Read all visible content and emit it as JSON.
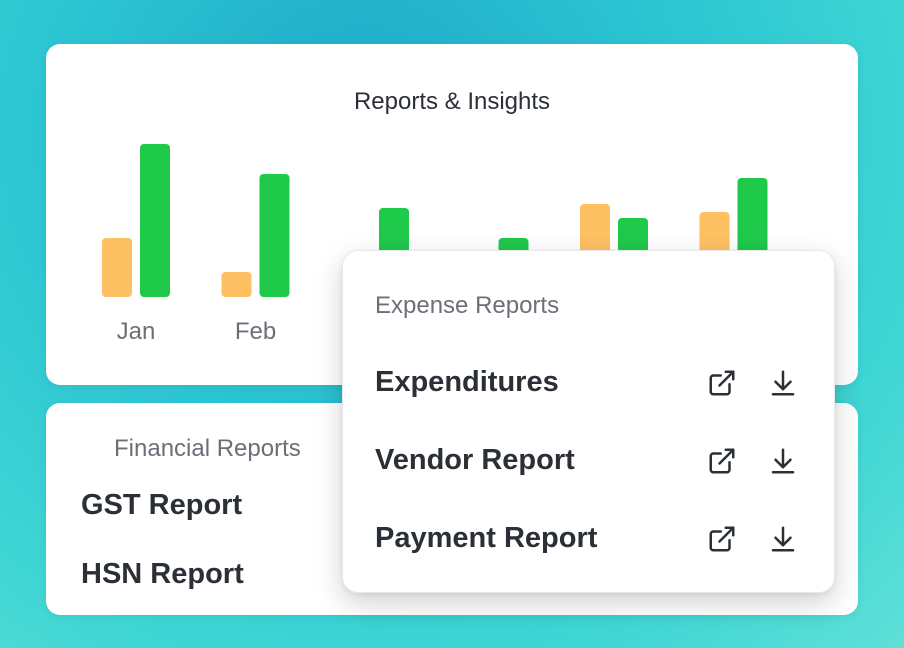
{
  "insights": {
    "title": "Reports & Insights"
  },
  "chart_data": {
    "type": "bar",
    "categories": [
      "Jan",
      "Feb",
      "",
      "",
      "",
      ""
    ],
    "visible_tick_labels": [
      "Jan",
      "Feb"
    ],
    "series": [
      {
        "values": [
          59,
          25,
          0,
          0,
          93,
          85
        ],
        "color": "#FDC062"
      },
      {
        "values": [
          153,
          123,
          89,
          59,
          79,
          119
        ],
        "color": "#1FC94A"
      }
    ],
    "ylim": [
      0,
      160
    ],
    "grid": false
  },
  "financial": {
    "heading": "Financial Reports",
    "items": [
      "GST Report",
      "HSN Report"
    ]
  },
  "expense": {
    "heading": "Expense Reports",
    "items": [
      {
        "label": "Expenditures",
        "icons": [
          "open-external-icon",
          "download-icon"
        ]
      },
      {
        "label": "Vendor Report",
        "icons": [
          "open-external-icon",
          "download-icon"
        ]
      },
      {
        "label": "Payment Report",
        "icons": [
          "open-external-icon",
          "download-icon"
        ]
      }
    ]
  },
  "colors": {
    "accent_green": "#1FC94A",
    "accent_orange": "#FDC062",
    "text_dark": "#2B2F36",
    "text_muted": "#6B7078"
  }
}
